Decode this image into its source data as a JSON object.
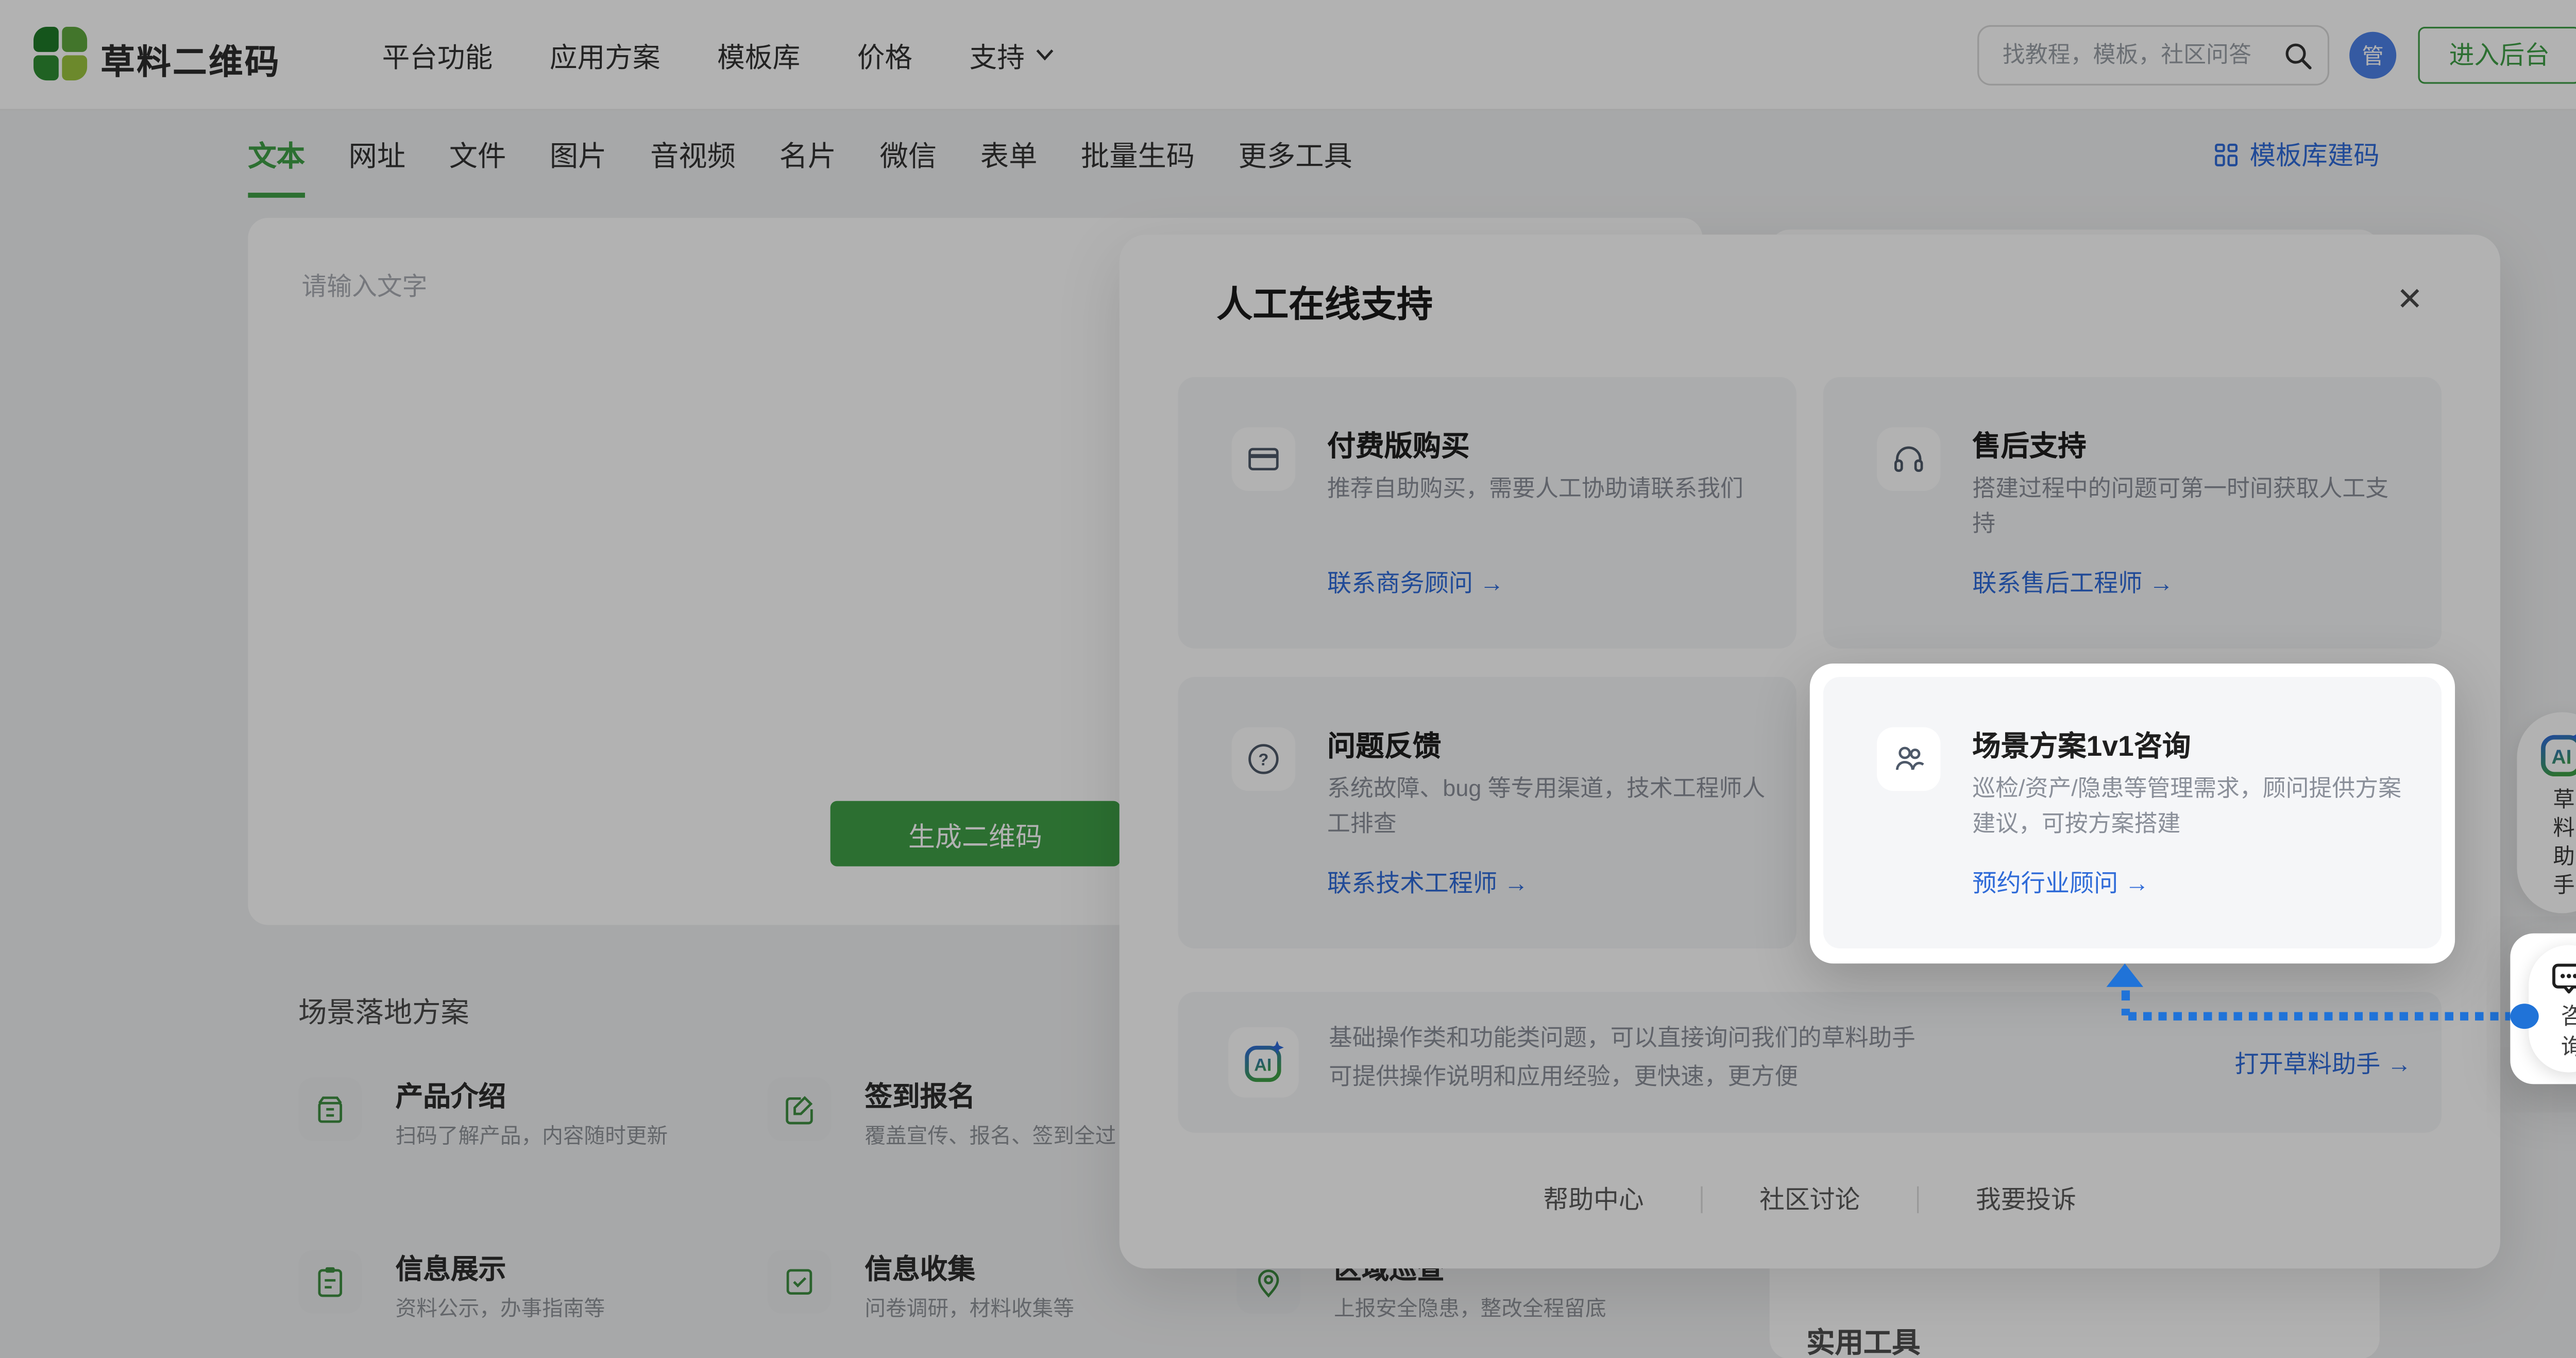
{
  "navbar": {
    "logo_text": "草料二维码",
    "menu": [
      "平台功能",
      "应用方案",
      "模板库",
      "价格",
      "支持"
    ],
    "search_placeholder": "找教程，模板，社区问答",
    "avatar": "管",
    "cta": "进入后台"
  },
  "tabs": {
    "items": [
      "文本",
      "网址",
      "文件",
      "图片",
      "音视频",
      "名片",
      "微信",
      "表单",
      "批量生码",
      "更多工具"
    ],
    "active": "文本",
    "template_link": "模板库建码"
  },
  "generator": {
    "input_placeholder": "请输入文字",
    "generate_button": "生成二维码"
  },
  "scene": {
    "heading": "场景落地方案",
    "items": [
      {
        "title": "产品介绍",
        "desc": "扫码了解产品，内容随时更新"
      },
      {
        "title": "签到报名",
        "desc": "覆盖宣传、报名、签到全过"
      },
      {
        "title": "信息展示",
        "desc": "资料公示，办事指南等"
      },
      {
        "title": "信息收集",
        "desc": "问卷调研，材料收集等"
      },
      {
        "title": "区域巡查",
        "desc": "上报安全隐患，整改全程留底"
      }
    ]
  },
  "tools_panel": {
    "heading": "实用工具"
  },
  "modal": {
    "title": "人工在线支持",
    "close": "✕",
    "cards": [
      {
        "icon": "bank-card-icon",
        "title": "付费版购买",
        "desc": "推荐自助购买，需要人工协助请联系我们",
        "link": "联系商务顾问",
        "highlighted": false
      },
      {
        "icon": "headset-icon",
        "title": "售后支持",
        "desc": "搭建过程中的问题可第一时间获取人工支持",
        "link": "联系售后工程师",
        "highlighted": false
      },
      {
        "icon": "question-icon",
        "title": "问题反馈",
        "desc": "系统故障、bug 等专用渠道，技术工程师人工排查",
        "link": "联系技术工程师",
        "highlighted": false
      },
      {
        "icon": "users-icon",
        "title": "场景方案1v1咨询",
        "desc": "巡检/资产/隐患等管理需求，顾问提供方案建议，可按方案搭建",
        "link": "预约行业顾问",
        "highlighted": true
      }
    ],
    "ai_row": {
      "line1": "基础操作类和功能类问题，可以直接询问我们的草料助手",
      "line2": "可提供操作说明和应用经验，更快速，更方便",
      "link": "打开草料助手"
    },
    "footer_links": [
      "帮助中心",
      "社区讨论",
      "我要投诉"
    ]
  },
  "floats": {
    "ai_assistant": "草料助手",
    "consult": "咨询"
  },
  "glyphs": {
    "arrow": "→"
  },
  "colors": {
    "brand_green": "#3FA047",
    "link_blue": "#2F6BD8",
    "arrow_blue": "#2073D8",
    "avatar_blue": "#4D82E8"
  }
}
